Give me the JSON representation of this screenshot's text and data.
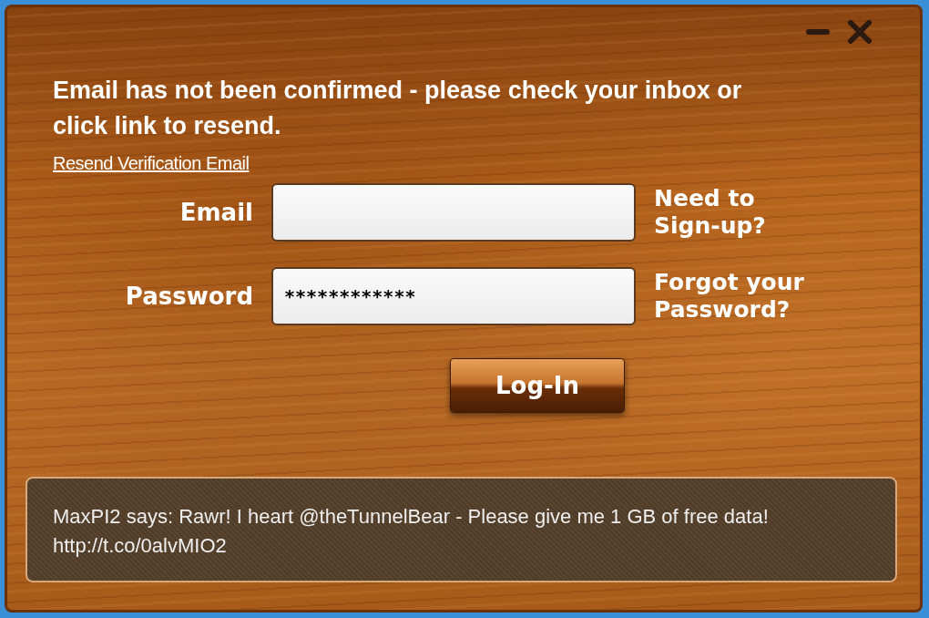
{
  "message": "Email has not been confirmed - please check your inbox or click link to resend.",
  "resend_link": "Resend Verification Email",
  "fields": [
    {
      "label": "Email",
      "side_link": "Need to Sign-up?"
    },
    {
      "label": "Password",
      "value": "************",
      "side_link": "Forgot your Password?"
    }
  ],
  "login_button": "Log-In",
  "footer": {
    "text": "MaxPI2 says: Rawr! I heart @theTunnelBear - Please give me 1 GB of free data! http://t.co/0alvMIO2"
  }
}
